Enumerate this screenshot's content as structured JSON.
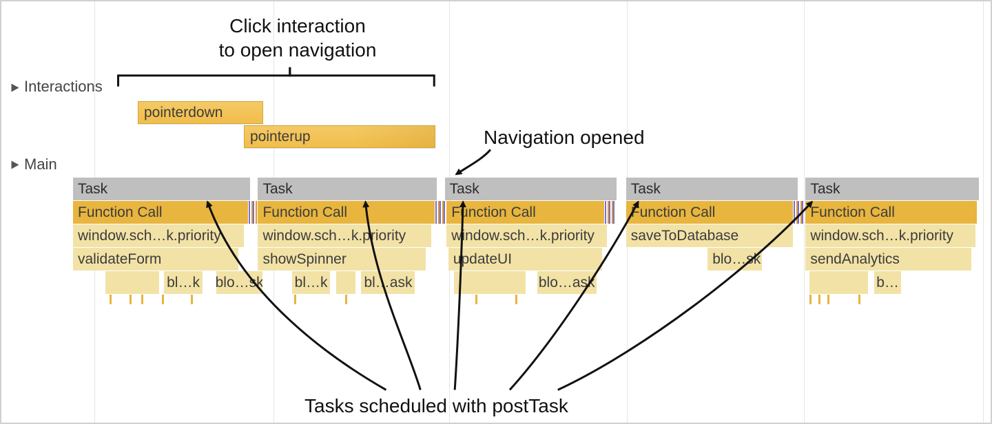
{
  "annotations": {
    "top_line1": "Click interaction",
    "top_line2": "to open navigation",
    "nav_opened": "Navigation opened",
    "bottom": "Tasks scheduled with postTask"
  },
  "tracks": {
    "interactions": "Interactions",
    "main": "Main"
  },
  "interactions": {
    "pointerdown": "pointerdown",
    "pointerup": "pointerup"
  },
  "main": {
    "task": "Task",
    "function_call": "Function Call",
    "col1": {
      "js1": "window.sch…k.priority",
      "js2": "validateForm",
      "tiny1": "bl…k",
      "tiny2": "blo…sk"
    },
    "col2": {
      "js1": "window.sch…k.priority",
      "js2": "showSpinner",
      "tiny1": "bl…k",
      "tiny2": "bl…ask"
    },
    "col3": {
      "js1": "window.sch…k.priority",
      "js2": "updateUI",
      "tiny1": "blo…ask"
    },
    "col4": {
      "js1": "saveToDatabase",
      "tiny1": "blo…sk"
    },
    "col5": {
      "js1": "window.sch…k.priority",
      "js2": "sendAnalytics",
      "tiny1": "b…"
    }
  }
}
